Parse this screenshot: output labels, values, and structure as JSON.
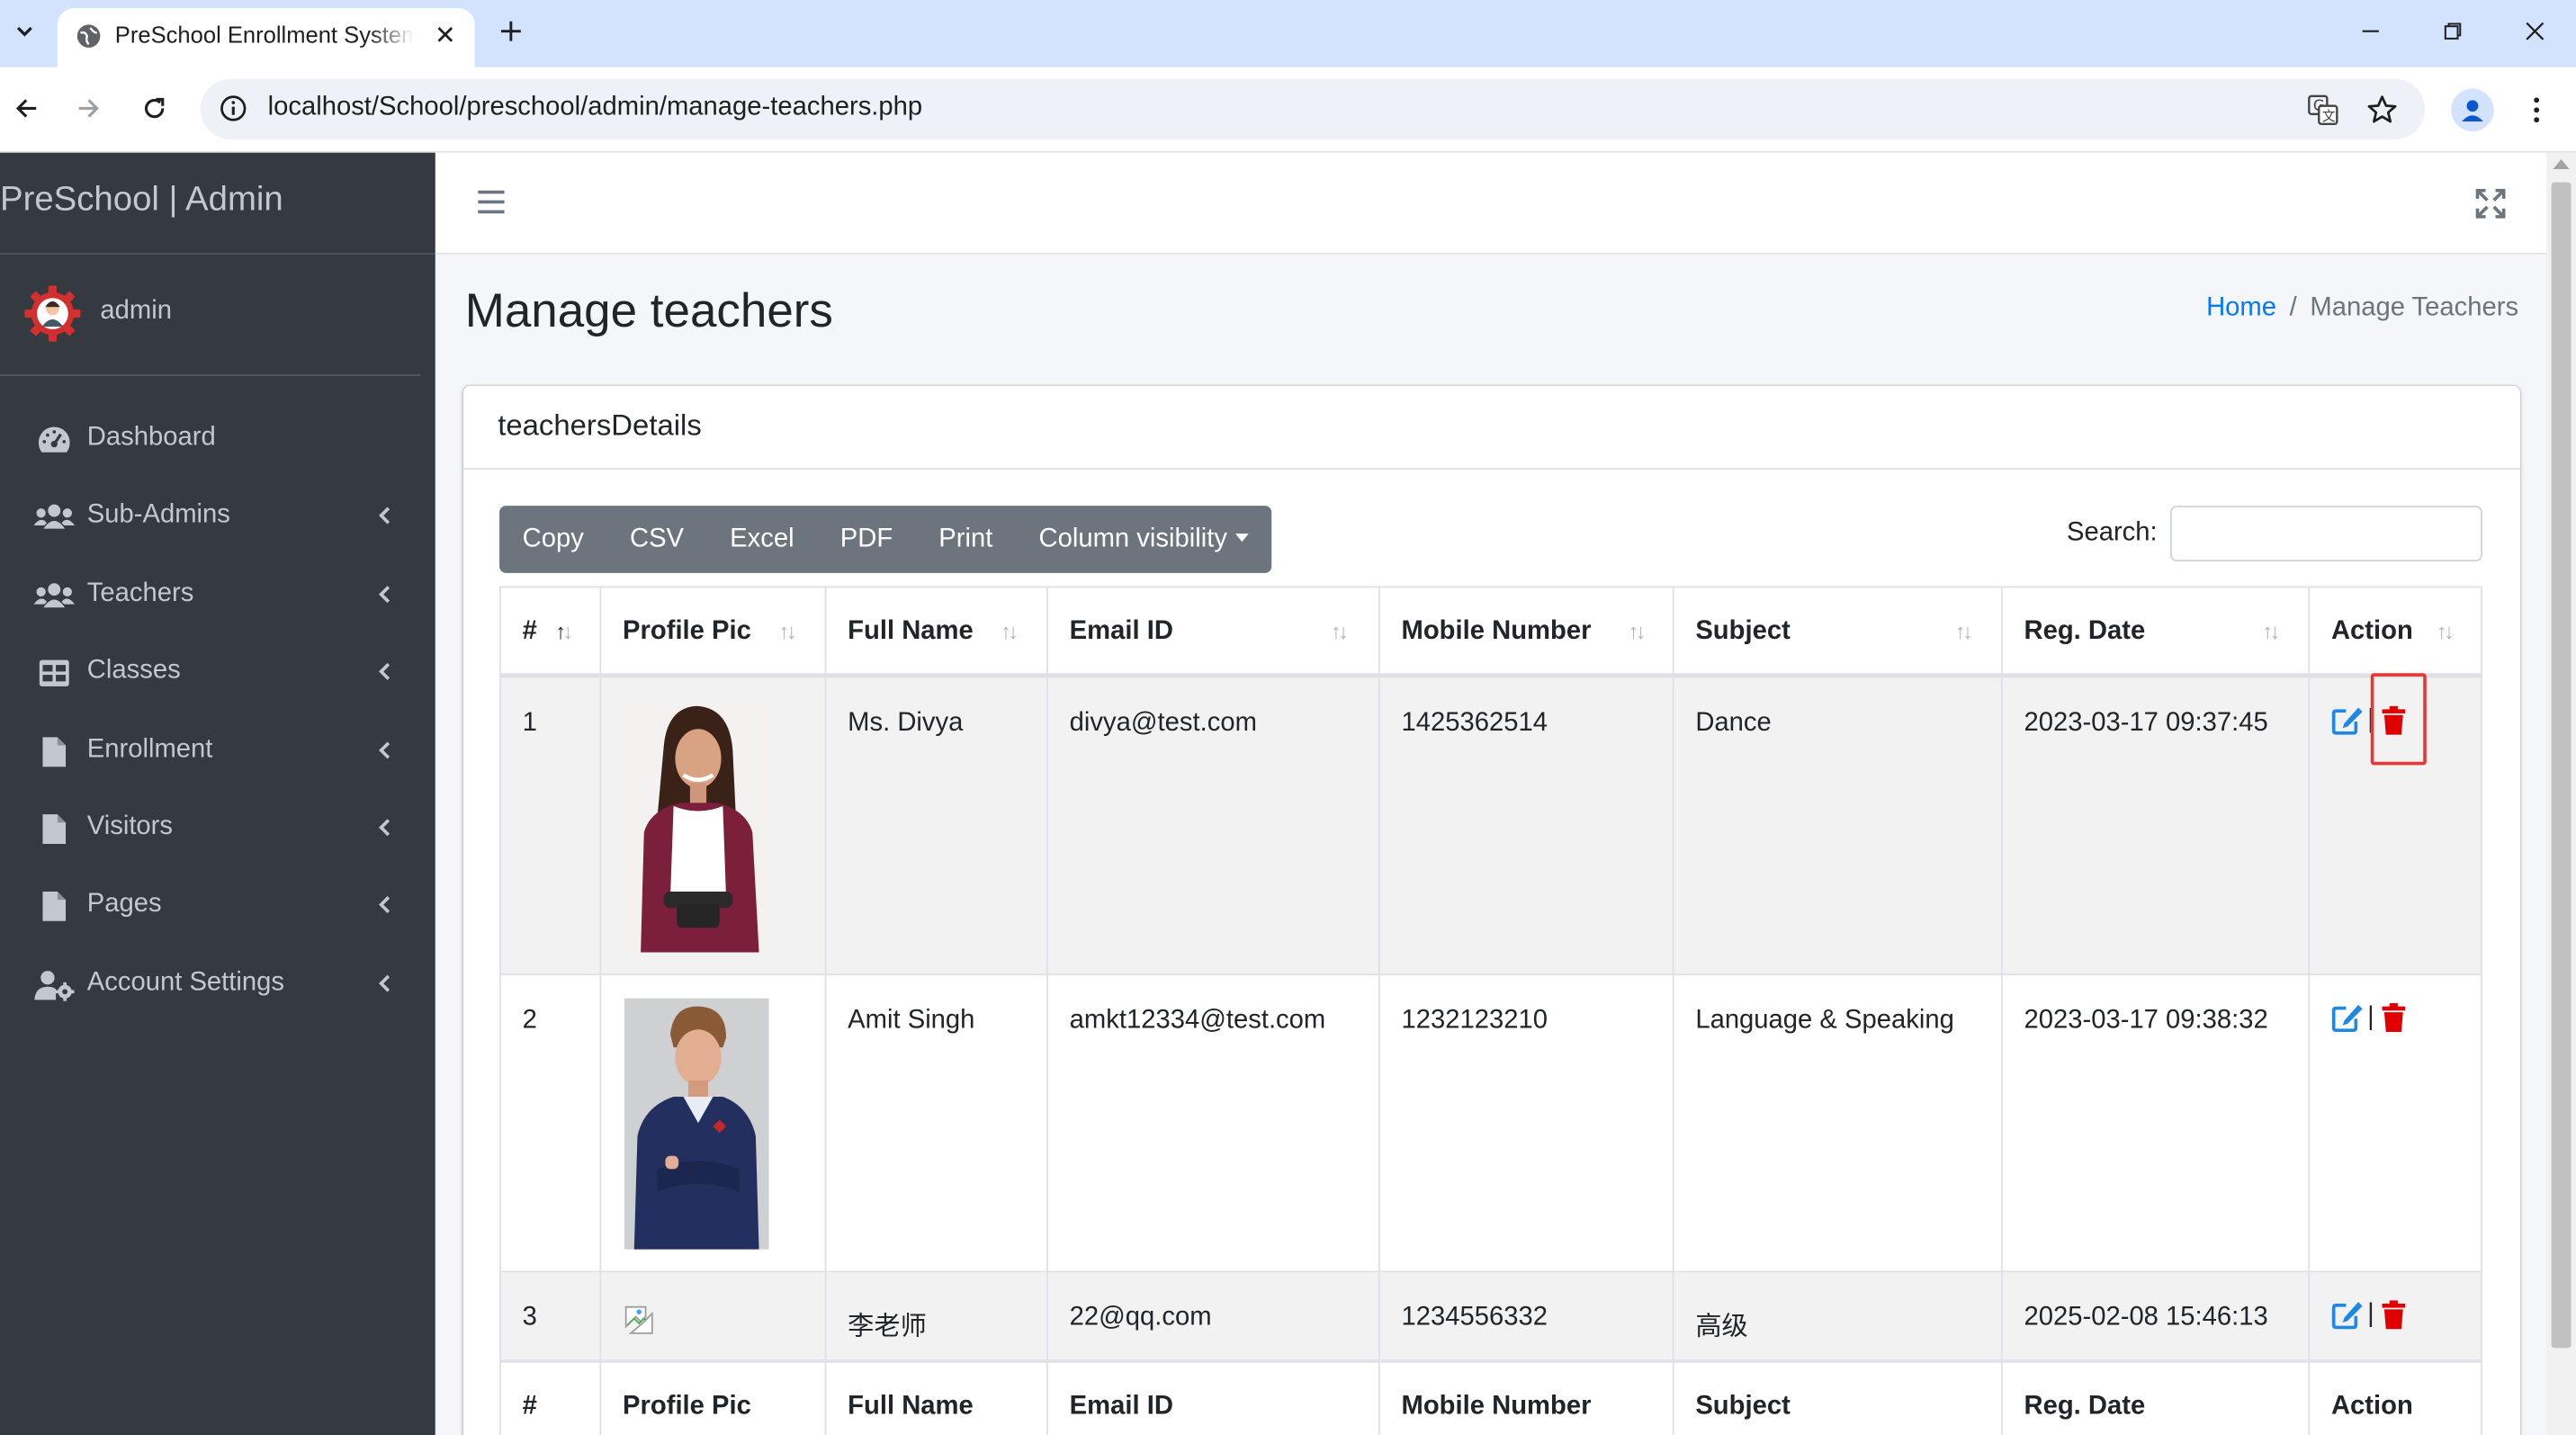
{
  "browser": {
    "tab_title": "PreSchool Enrollment System",
    "url": "localhost/School/preschool/admin/manage-teachers.php",
    "icons": [
      "tab-list-icon",
      "globe-icon",
      "close-icon",
      "plus-icon",
      "minimize-icon",
      "restore-icon",
      "close-window-icon",
      "back-icon",
      "forward-icon",
      "reload-icon",
      "info-icon",
      "translate-icon",
      "star-icon",
      "profile-icon",
      "kebab-menu-icon"
    ]
  },
  "sidebar": {
    "brand": "PreSchool | Admin",
    "user": "admin",
    "items": [
      {
        "label": "Dashboard",
        "icon": "tachometer-icon",
        "has_children": false
      },
      {
        "label": "Sub-Admins",
        "icon": "users-icon",
        "has_children": true
      },
      {
        "label": "Teachers",
        "icon": "users-icon",
        "has_children": true
      },
      {
        "label": "Classes",
        "icon": "table-icon",
        "has_children": true
      },
      {
        "label": "Enrollment",
        "icon": "file-icon",
        "has_children": true
      },
      {
        "label": "Visitors",
        "icon": "file-icon",
        "has_children": true
      },
      {
        "label": "Pages",
        "icon": "file-icon",
        "has_children": true
      },
      {
        "label": "Account Settings",
        "icon": "user-cog-icon",
        "has_children": true
      }
    ]
  },
  "header": {
    "page_title": "Manage teachers",
    "breadcrumb": {
      "home": "Home",
      "separator": "/",
      "active": "Manage Teachers"
    }
  },
  "card": {
    "title": "teachersDetails",
    "buttons": [
      "Copy",
      "CSV",
      "Excel",
      "PDF",
      "Print",
      "Column visibility"
    ],
    "search_label": "Search:",
    "search_value": ""
  },
  "table": {
    "columns": [
      "#",
      "Profile Pic",
      "Full Name",
      "Email ID",
      "Mobile Number",
      "Subject",
      "Reg. Date",
      "Action"
    ],
    "sorted_column": "#",
    "sort_direction": "ascending",
    "rows": [
      {
        "num": "1",
        "photo": "woman-portrait",
        "name": "Ms. Divya",
        "email": "divya@test.com",
        "mobile": "1425362514",
        "subject": "Dance",
        "reg_date": "2023-03-17 09:37:45",
        "separator": "|"
      },
      {
        "num": "2",
        "photo": "man-portrait",
        "name": "Amit Singh",
        "email": "amkt12334@test.com",
        "mobile": "1232123210",
        "subject": "Language & Speaking",
        "reg_date": "2023-03-17 09:38:32",
        "separator": "|"
      },
      {
        "num": "3",
        "photo": "broken-image",
        "name": "李老师",
        "email": "22@qq.com",
        "mobile": "1234556332",
        "subject": "高级",
        "reg_date": "2025-02-08 15:46:13",
        "separator": "|"
      }
    ],
    "footer_columns": [
      "#",
      "Profile Pic",
      "Full Name",
      "Email ID",
      "Mobile Number",
      "Subject",
      "Reg. Date",
      "Action"
    ]
  },
  "colors": {
    "sidebar_bg": "#343a40",
    "sidebar_text": "#c2c7d0",
    "link": "#007bff",
    "button_group": "#6c757d",
    "edit_icon": "#1e88e5",
    "delete_icon": "#e00000",
    "highlight_box": "#e53935",
    "tab_strip": "#d3e3fd"
  }
}
